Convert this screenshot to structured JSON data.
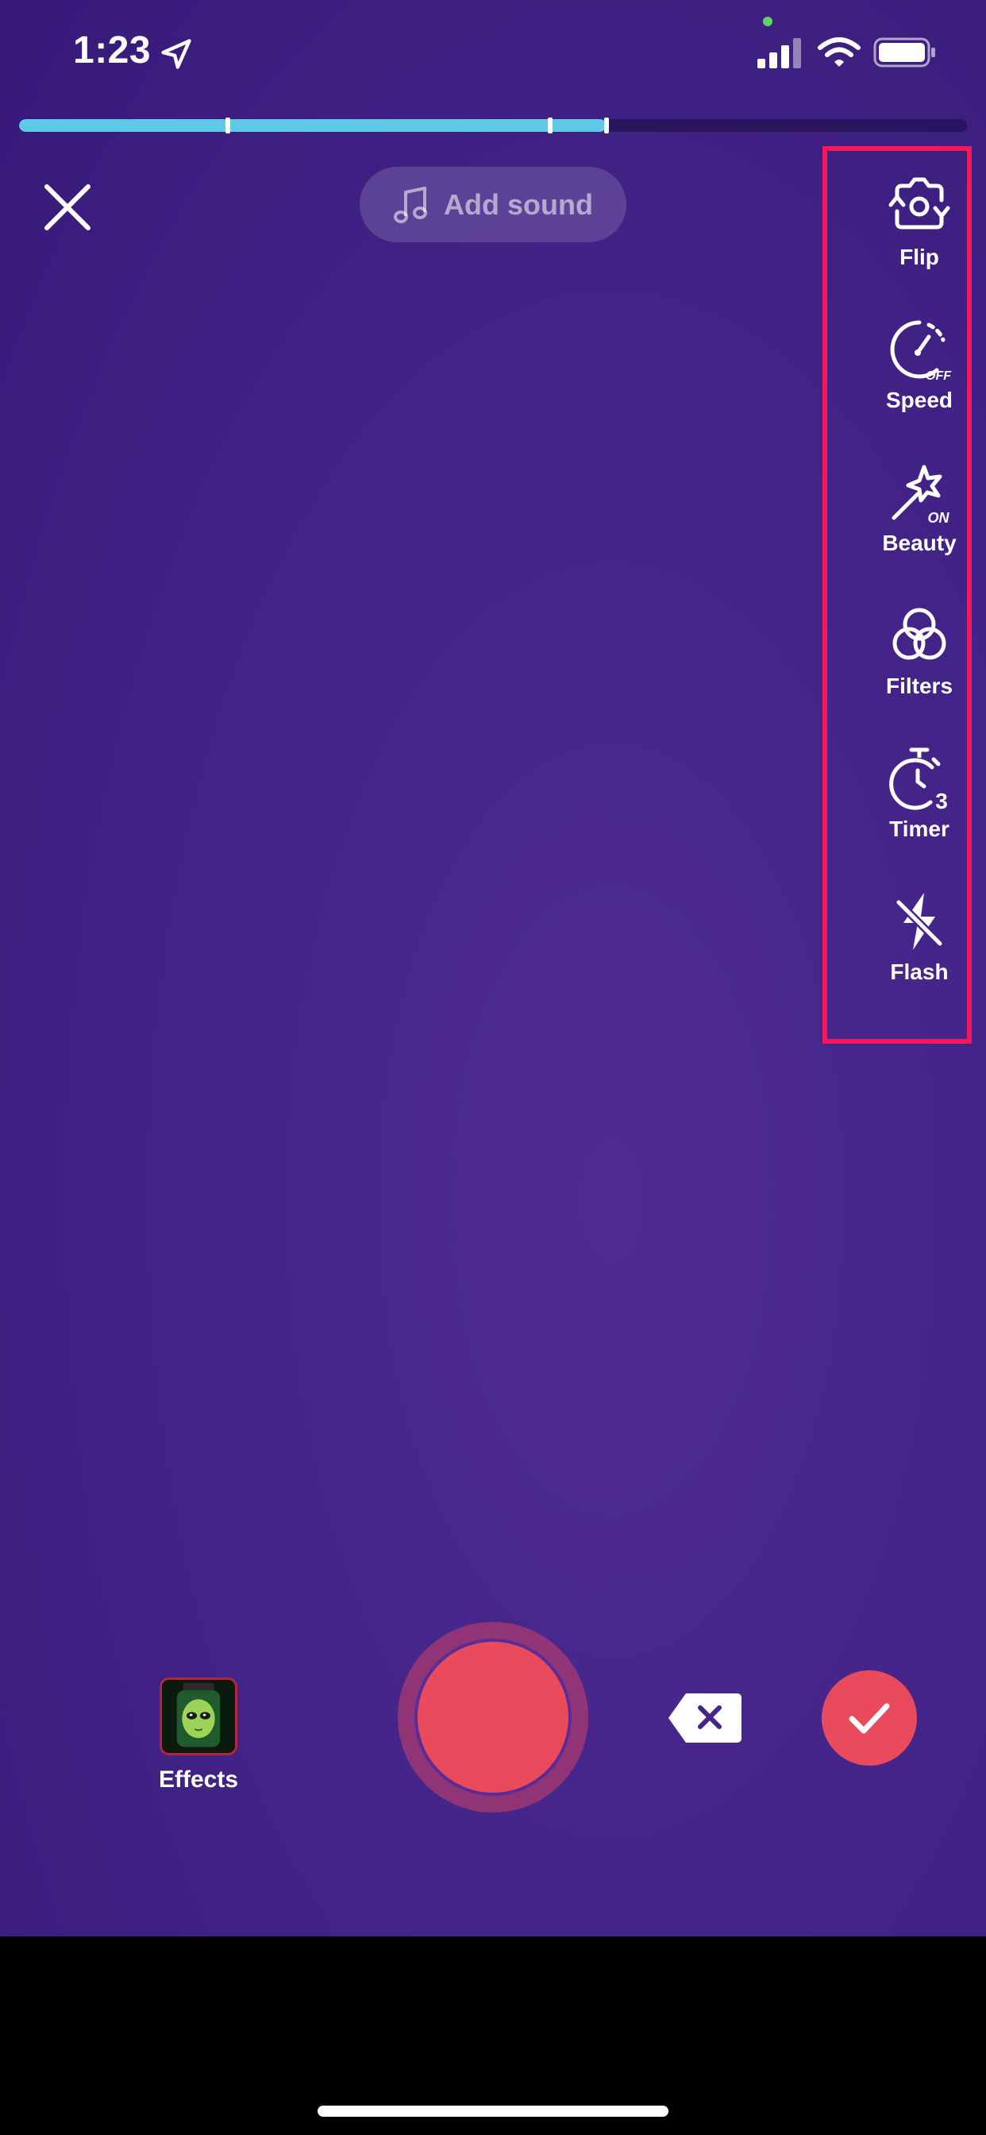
{
  "status_bar": {
    "time": "1:23"
  },
  "recording": {
    "progress": 0.62,
    "segment_marks": [
      0.22,
      0.56
    ]
  },
  "top_bar": {
    "add_sound_label": "Add sound"
  },
  "tools": [
    {
      "id": "flip",
      "label": "Flip",
      "icon": "flip-camera-icon"
    },
    {
      "id": "speed",
      "label": "Speed",
      "icon": "speed-gauge-icon",
      "badge": "OFF"
    },
    {
      "id": "beauty",
      "label": "Beauty",
      "icon": "magic-wand-icon",
      "badge": "ON"
    },
    {
      "id": "filters",
      "label": "Filters",
      "icon": "filters-circles-icon"
    },
    {
      "id": "timer",
      "label": "Timer",
      "icon": "stopwatch-icon",
      "badge": "3"
    },
    {
      "id": "flash",
      "label": "Flash",
      "icon": "flash-off-icon"
    }
  ],
  "bottom_bar": {
    "effects_label": "Effects"
  },
  "colors": {
    "accent_red": "#ea4b5c",
    "progress_blue": "#5fc8e6",
    "highlight_pink": "#f5195b",
    "background_purple": "#45258a"
  }
}
